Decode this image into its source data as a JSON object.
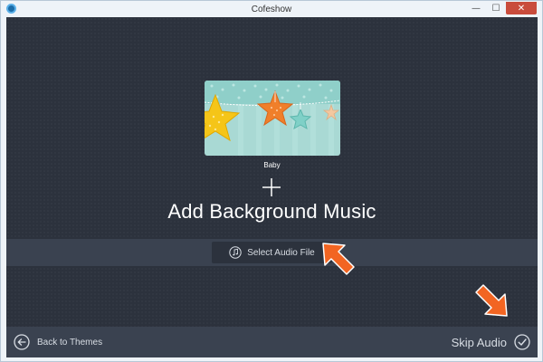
{
  "window": {
    "title": "Cofeshow",
    "minimize_glyph": "—",
    "maximize_glyph": "☐",
    "close_glyph": "✕"
  },
  "theme": {
    "name": "Baby",
    "thumbnail_icon": "baby-stars-thumbnail"
  },
  "main": {
    "title": "Add Background Music",
    "select_audio_label": "Select Audio File",
    "select_audio_icon": "music-note-icon"
  },
  "footer": {
    "back_label": "Back to Themes",
    "back_icon": "arrow-left-circle-icon",
    "skip_label": "Skip Audio",
    "skip_icon": "checkmark-circle-icon"
  },
  "colors": {
    "background": "#2c323d",
    "band": "#3a4250",
    "arrow_accent": "#f26522",
    "close_button": "#c94c3c"
  }
}
